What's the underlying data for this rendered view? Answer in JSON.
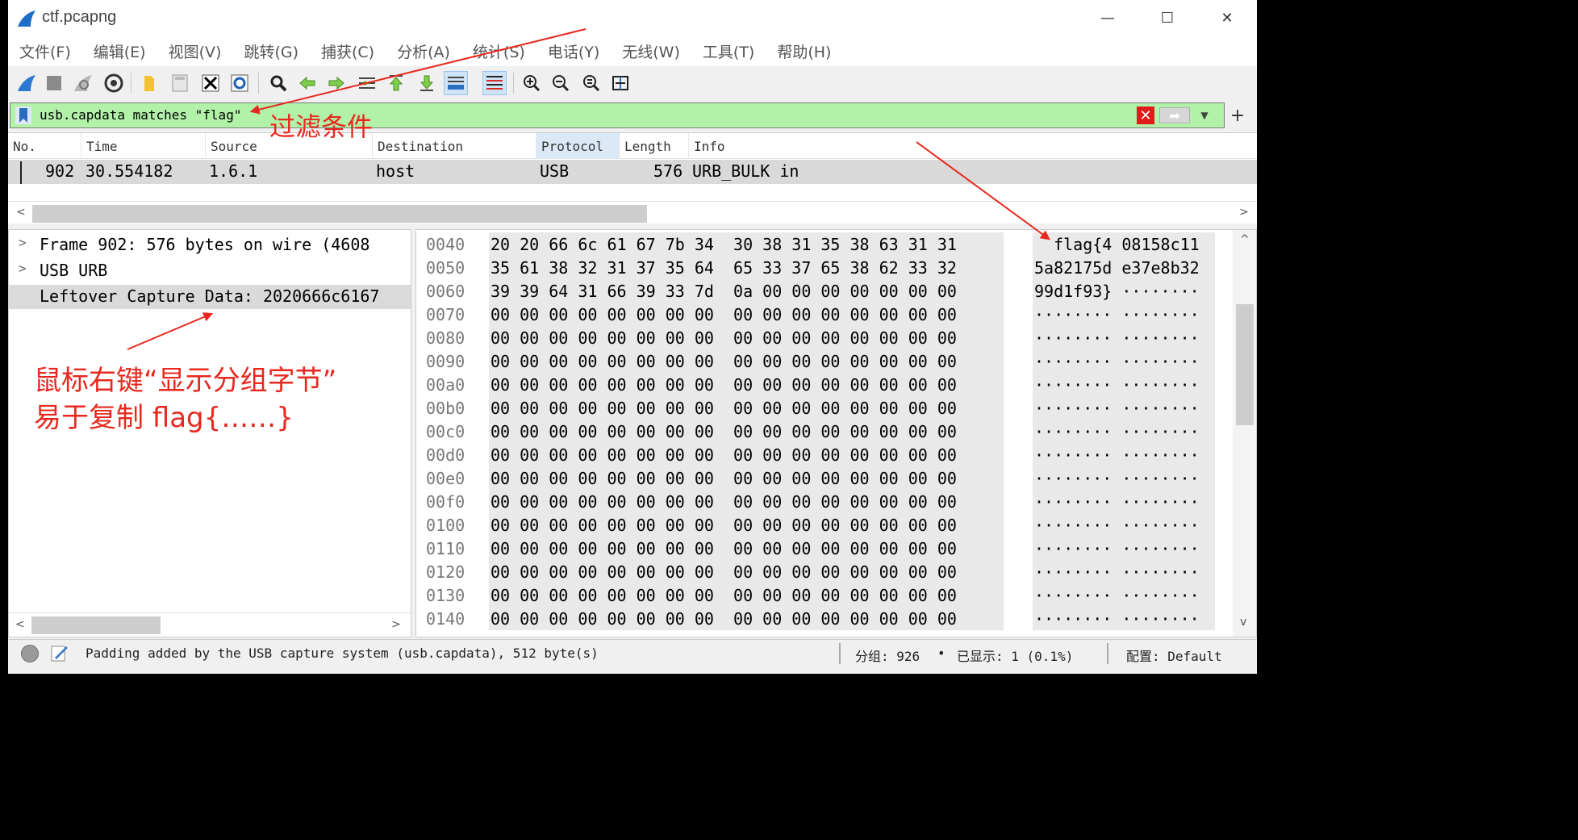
{
  "window": {
    "title": "ctf.pcapng",
    "minimize": "—",
    "maximize": "☐",
    "close": "✕"
  },
  "menu": [
    "文件(F)",
    "编辑(E)",
    "视图(V)",
    "跳转(G)",
    "捕获(C)",
    "分析(A)",
    "统计(S)",
    "电话(Y)",
    "无线(W)",
    "工具(T)",
    "帮助(H)"
  ],
  "toolbar": {
    "icons": [
      "shark-fin-start-icon",
      "stop-square-icon",
      "restart-fin-icon",
      "capture-options-gear-icon",
      "open-folder-icon",
      "save-file-icon",
      "close-file-icon",
      "reload-icon",
      "find-packet-icon",
      "go-back-icon",
      "go-forward-icon",
      "go-to-packet-icon",
      "go-first-icon",
      "go-last-icon",
      "auto-scroll-icon",
      "colorize-icon",
      "zoom-in-icon",
      "zoom-out-icon",
      "normal-size-icon",
      "resize-columns-icon"
    ]
  },
  "filter": {
    "value": "usb.capdata matches \"flag\"",
    "clear": "✕",
    "apply": "➡",
    "dropdown": "▼",
    "add": "+"
  },
  "packet_list": {
    "columns": [
      "No.",
      "Time",
      "Source",
      "Destination",
      "Protocol",
      "Length",
      "Info"
    ],
    "sorted_column": "Protocol",
    "rows": [
      {
        "no": "902",
        "time": "30.554182",
        "source": "1.6.1",
        "destination": "host",
        "protocol": "USB",
        "length": "576",
        "info": "URB_BULK in"
      }
    ],
    "scroll_left": "<",
    "scroll_right": ">"
  },
  "details": {
    "items": [
      {
        "arrow": ">",
        "text": "Frame 902: 576 bytes on wire (4608"
      },
      {
        "arrow": ">",
        "text": "USB URB"
      },
      {
        "arrow": "",
        "text": "Leftover Capture Data: 2020666c6167"
      }
    ],
    "scroll_left": "<",
    "scroll_right": ">"
  },
  "bytes": {
    "rows": [
      {
        "offset": "0040",
        "hex": "20 20 66 6c 61 67 7b 34  30 38 31 35 38 63 31 31",
        "ascii": "  flag{4 08158c11"
      },
      {
        "offset": "0050",
        "hex": "35 61 38 32 31 37 35 64  65 33 37 65 38 62 33 32",
        "ascii": "5a82175d e37e8b32"
      },
      {
        "offset": "0060",
        "hex": "39 39 64 31 66 39 33 7d  0a 00 00 00 00 00 00 00",
        "ascii": "99d1f93} ········"
      },
      {
        "offset": "0070",
        "hex": "00 00 00 00 00 00 00 00  00 00 00 00 00 00 00 00",
        "ascii": "········ ········"
      },
      {
        "offset": "0080",
        "hex": "00 00 00 00 00 00 00 00  00 00 00 00 00 00 00 00",
        "ascii": "········ ········"
      },
      {
        "offset": "0090",
        "hex": "00 00 00 00 00 00 00 00  00 00 00 00 00 00 00 00",
        "ascii": "········ ········"
      },
      {
        "offset": "00a0",
        "hex": "00 00 00 00 00 00 00 00  00 00 00 00 00 00 00 00",
        "ascii": "········ ········"
      },
      {
        "offset": "00b0",
        "hex": "00 00 00 00 00 00 00 00  00 00 00 00 00 00 00 00",
        "ascii": "········ ········"
      },
      {
        "offset": "00c0",
        "hex": "00 00 00 00 00 00 00 00  00 00 00 00 00 00 00 00",
        "ascii": "········ ········"
      },
      {
        "offset": "00d0",
        "hex": "00 00 00 00 00 00 00 00  00 00 00 00 00 00 00 00",
        "ascii": "········ ········"
      },
      {
        "offset": "00e0",
        "hex": "00 00 00 00 00 00 00 00  00 00 00 00 00 00 00 00",
        "ascii": "········ ········"
      },
      {
        "offset": "00f0",
        "hex": "00 00 00 00 00 00 00 00  00 00 00 00 00 00 00 00",
        "ascii": "········ ········"
      },
      {
        "offset": "0100",
        "hex": "00 00 00 00 00 00 00 00  00 00 00 00 00 00 00 00",
        "ascii": "········ ········"
      },
      {
        "offset": "0110",
        "hex": "00 00 00 00 00 00 00 00  00 00 00 00 00 00 00 00",
        "ascii": "········ ········"
      },
      {
        "offset": "0120",
        "hex": "00 00 00 00 00 00 00 00  00 00 00 00 00 00 00 00",
        "ascii": "········ ········"
      },
      {
        "offset": "0130",
        "hex": "00 00 00 00 00 00 00 00  00 00 00 00 00 00 00 00",
        "ascii": "········ ········"
      },
      {
        "offset": "0140",
        "hex": "00 00 00 00 00 00 00 00  00 00 00 00 00 00 00 00",
        "ascii": "········ ········"
      }
    ],
    "scroll_up": "^",
    "scroll_down": "v"
  },
  "status": {
    "message": "Padding added by the USB capture system (usb.capdata), 512 byte(s)",
    "packets": "分组: 926",
    "dot": "•",
    "displayed": "已显示: 1 (0.1%)",
    "profile": "配置: Default"
  },
  "annotations": {
    "filter_note": "过滤条件",
    "copy_line1": "鼠标右键“显示分组字节”",
    "copy_line2": "易于复制 flag{……}"
  },
  "colors": {
    "filter_valid_bg": "#b1f2a8",
    "annotation_red": "#e8281e",
    "selected_row_bg": "#d9d9d9"
  }
}
